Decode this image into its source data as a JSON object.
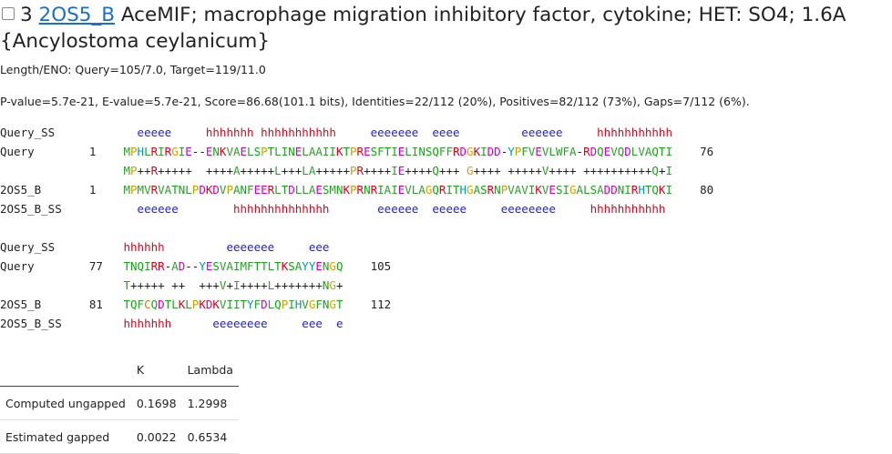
{
  "header": {
    "rank": "3",
    "hit_id": "2OS5_B",
    "description": "AceMIF; macrophage migration inhibitory factor, cytokine; HET: SO4; 1.6A",
    "organism": "{Ancylostoma ceylanicum}"
  },
  "length_eno": "Length/ENO: Query=105/7.0, Target=119/11.0",
  "scores": "P-value=5.7e-21, E-value=5.7e-21, Score=86.68(101.1 bits), Identities=22/112 (20%), Positives=82/112 (73%), Gaps=7/112 (6%).",
  "alignment_blocks": [
    {
      "rows": [
        {
          "label": "Query_SS",
          "start": "",
          "seq": "  eeeee     hhhhhhh hhhhhhhhhhh     eeeeeee  eeee         eeeeee     hhhhhhhhhhh",
          "end": "",
          "kind": "ss"
        },
        {
          "label": "Query",
          "start": "1",
          "seq": "MPHLRIRGIE--ENKVAELSPTLINELAAIIKTPRESFTIELINSQFFRDGKIDD-YPFVEVLWFA-RDQEVQDLVAQTI",
          "end": "76",
          "kind": "seq"
        },
        {
          "label": "",
          "start": "",
          "seq": "MP++R+++++  ++++A+++++L+++LA+++++PR++++IE++++Q+++ G++++ +++++V++++ ++++++++++Q+I",
          "end": "",
          "kind": "match"
        },
        {
          "label": "2OS5_B",
          "start": "1",
          "seq": "MPMVRVATNLPDKDVPANFEERLTDLLAESMNKPRNRIAIEVLAGQRITHGASRNPVAVIKVESIGALSADDNIRHTQKI",
          "end": "80",
          "kind": "seq"
        },
        {
          "label": "2OS5_B_SS",
          "start": "",
          "seq": "  eeeeee        hhhhhhhhhhhhhh       eeeeee  eeeee     eeeeeeee     hhhhhhhhhhh",
          "end": "",
          "kind": "ss"
        }
      ]
    },
    {
      "rows": [
        {
          "label": "Query_SS",
          "start": "",
          "seq": "hhhhhh         eeeeeee     eee",
          "end": "",
          "kind": "ss"
        },
        {
          "label": "Query",
          "start": "77",
          "seq": "TNQIRR-AD--YESVAIMFTTLTKSAYYENGQ",
          "end": "105",
          "kind": "seq"
        },
        {
          "label": "",
          "start": "",
          "seq": "T+++++ ++  +++V+I++++L+++++++NG+",
          "end": "",
          "kind": "match"
        },
        {
          "label": "2OS5_B",
          "start": "81",
          "seq": "TQFCQDTLKLPKDKVIITYFDLQPIHVGFNGT",
          "end": "112",
          "kind": "seq"
        },
        {
          "label": "2OS5_B_SS",
          "start": "",
          "seq": "hhhhhhh      eeeeeeee     eee  e",
          "end": "",
          "kind": "ss"
        }
      ]
    }
  ],
  "stats_table": {
    "headers": [
      "",
      "K",
      "Lambda"
    ],
    "rows": [
      [
        "Computed ungapped",
        "0.1698",
        "1.2998"
      ],
      [
        "Estimated gapped",
        "0.0022",
        "0.6534"
      ]
    ]
  },
  "colors": {
    "link": "#1a6fc9",
    "helix": "#e0001a",
    "strand": "#1f1fd6"
  }
}
